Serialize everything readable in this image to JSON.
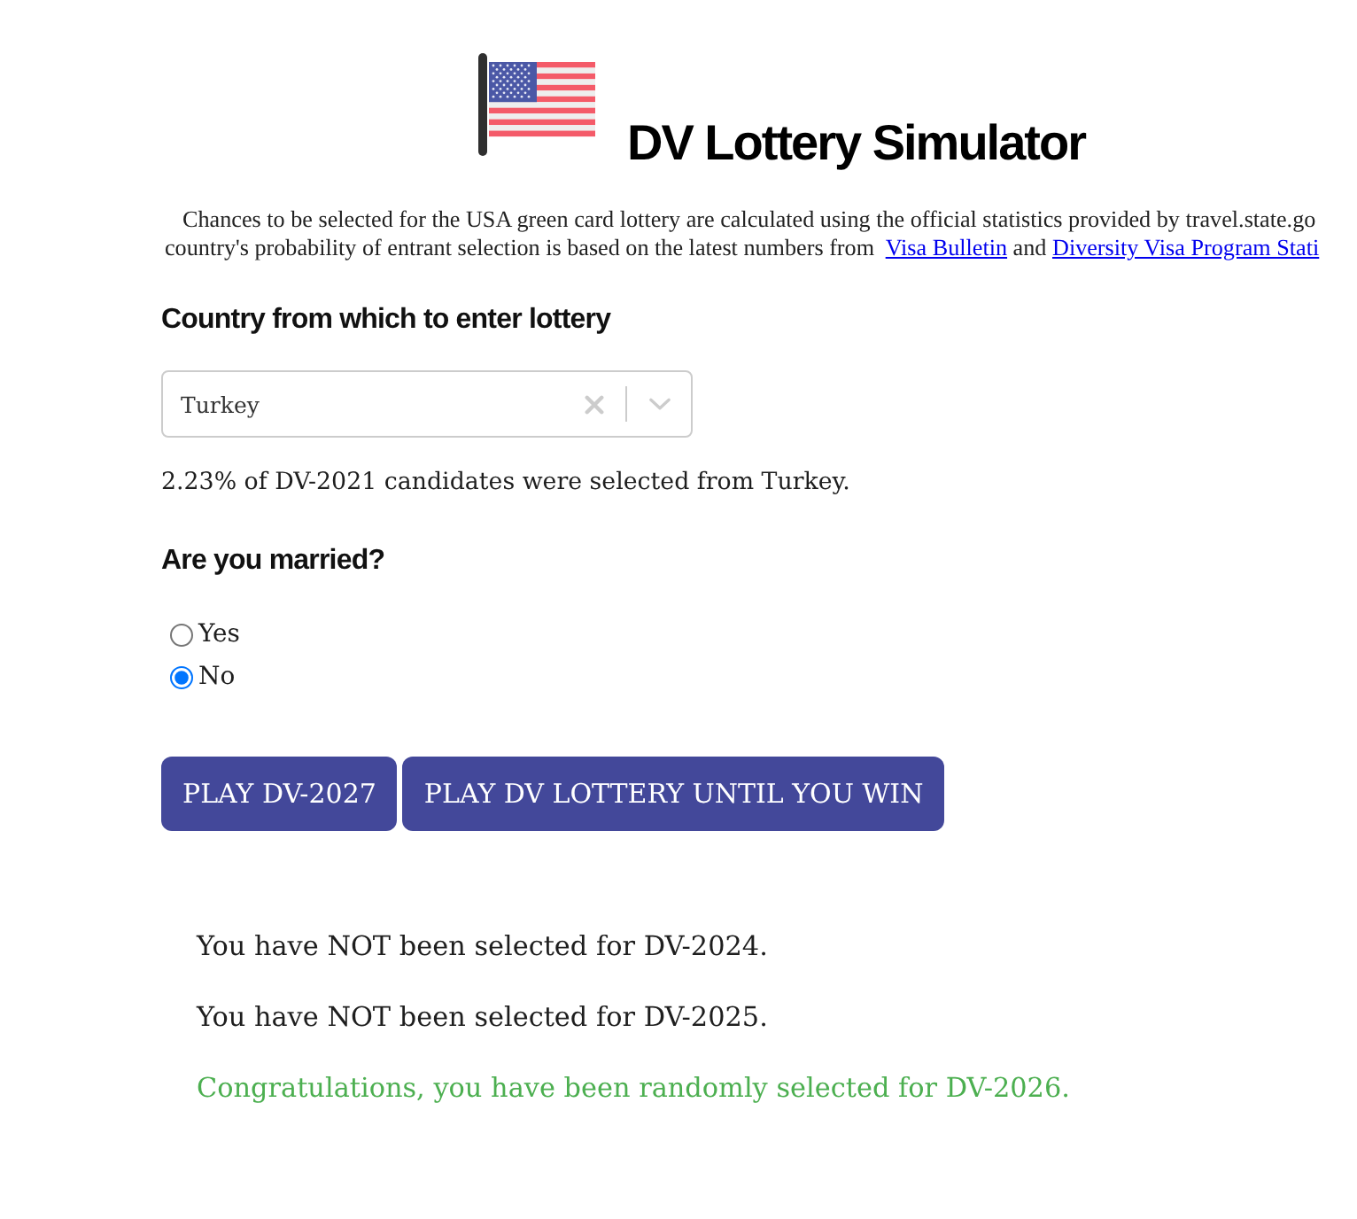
{
  "header": {
    "title": "DV Lottery Simulator"
  },
  "intro": {
    "line_1": "Chances to be selected for the USA green card lottery are calculated using the official statistics provided by travel.state.go",
    "line_2": "country's probability of entrant selection is based on the latest numbers from",
    "links": [
      "Visa Bulletin",
      "Diversity Visa Program Stati"
    ],
    "conjunction": "and"
  },
  "country": {
    "heading": "Country from which to enter lottery",
    "value": "Turkey",
    "note": "2.23% of DV-2021 candidates were selected from Turkey."
  },
  "married": {
    "heading": "Are you married?",
    "options": [
      {
        "label": "Yes",
        "selected": false
      },
      {
        "label": "No",
        "selected": true
      }
    ]
  },
  "buttons": [
    "PLAY DV-2027",
    "PLAY DV LOTTERY UNTIL YOU WIN"
  ],
  "results": [
    {
      "text": "You have NOT been selected for DV-2024.",
      "won": false
    },
    {
      "text": "You have NOT been selected for DV-2025.",
      "won": false
    },
    {
      "text": "Congratulations, you have been randomly selected for DV-2026.",
      "won": true
    }
  ]
}
